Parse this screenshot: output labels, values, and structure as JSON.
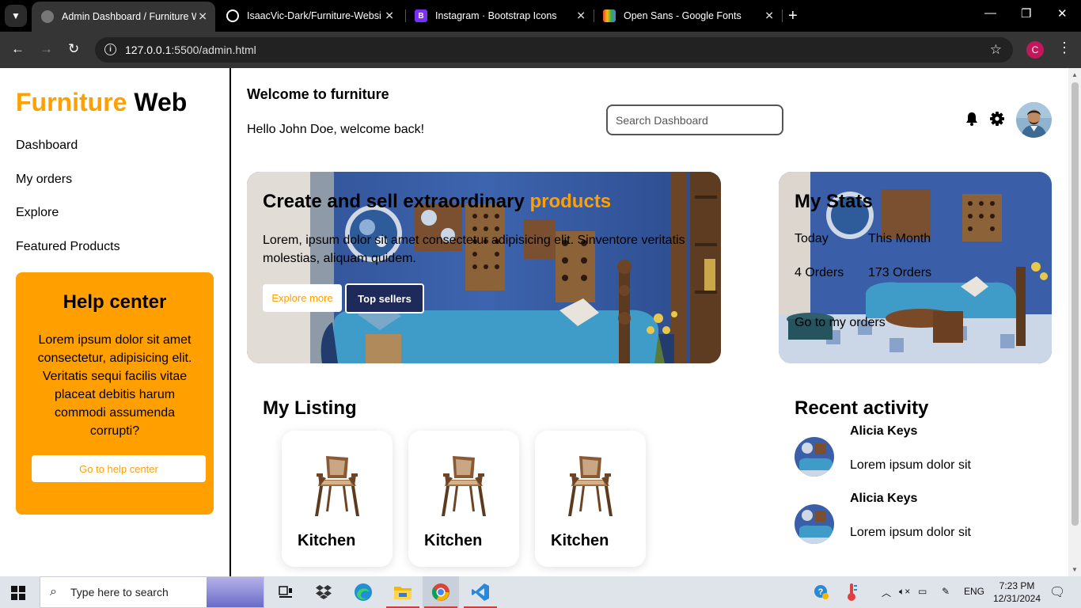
{
  "browser": {
    "tabs": [
      {
        "title": "Admin Dashboard / Furniture W",
        "active": true
      },
      {
        "title": "IsaacVic-Dark/Furniture-Websit",
        "active": false
      },
      {
        "title": "Instagram · Bootstrap Icons",
        "active": false
      },
      {
        "title": "Open Sans - Google Fonts",
        "active": false
      }
    ],
    "url_host": "127.0.0.1",
    "url_path": ":5500/admin.html",
    "profile_initial": "C"
  },
  "sidebar": {
    "logo_part1": "Furniture",
    "logo_part2": "Web",
    "nav": [
      "Dashboard",
      "My orders",
      "Explore",
      "Featured Products"
    ],
    "help": {
      "title": "Help center",
      "text": "Lorem ipsum dolor sit amet consectetur, adipisicing elit. Veritatis sequi facilis vitae placeat debitis harum commodi assumenda corrupti?",
      "button": "Go to help center"
    }
  },
  "header": {
    "title": "Welcome to furniture",
    "greeting": "Hello John Doe, welcome back!",
    "search_placeholder": "Search Dashboard"
  },
  "hero": {
    "title": "Create and sell extraordinary",
    "title_accent": "products",
    "text": "Lorem, ipsum dolor sit amet consectetur adipisicing elit. Sinventore veritatis molestias, aliquam quidem.",
    "explore_button": "Explore more",
    "top_button": "Top sellers"
  },
  "stats": {
    "title": "My Stats",
    "today_label": "Today",
    "month_label": "This Month",
    "today_value": "4 Orders",
    "month_value": "173 Orders",
    "link": "Go to my orders"
  },
  "listing": {
    "title": "My Listing",
    "items": [
      "Kitchen",
      "Kitchen",
      "Kitchen"
    ]
  },
  "activity": {
    "title": "Recent activity",
    "items": [
      {
        "name": "Alicia Keys",
        "text": "Lorem ipsum dolor sit"
      },
      {
        "name": "Alicia Keys",
        "text": "Lorem ipsum dolor sit"
      }
    ]
  },
  "taskbar": {
    "search_placeholder": "Type here to search",
    "lang": "ENG",
    "time": "7:23 PM",
    "date": "12/31/2024"
  },
  "colors": {
    "accent": "#ffa000",
    "room_blue": "#3a5fa8",
    "sofa": "#3f9cc8"
  }
}
